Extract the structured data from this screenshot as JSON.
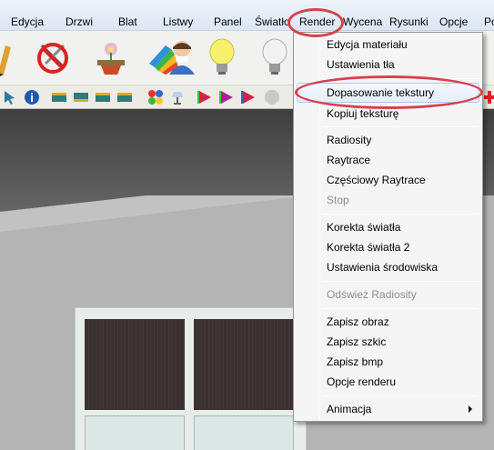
{
  "menubar": {
    "items": [
      "Edycja",
      "Drzwi",
      "Blat",
      "Listwy",
      "Panel",
      "Światło",
      "Render",
      "Wycena",
      "Rysunki",
      "Opcje",
      "Pomoc"
    ]
  },
  "render_menu": {
    "items": [
      {
        "label": "Edycja materiału",
        "enabled": true
      },
      {
        "label": "Ustawienia tła",
        "enabled": true
      },
      {
        "label": "Dopasowanie tekstury",
        "enabled": true,
        "highlighted": true
      },
      {
        "label": "Kopiuj teksturę",
        "enabled": true
      },
      {
        "label": "Radiosity",
        "enabled": true
      },
      {
        "label": "Raytrace",
        "enabled": true
      },
      {
        "label": "Częściowy Raytrace",
        "enabled": true
      },
      {
        "label": "Stop",
        "enabled": false
      },
      {
        "label": "Korekta światła",
        "enabled": true
      },
      {
        "label": "Korekta światła 2",
        "enabled": true
      },
      {
        "label": "Ustawienia środowiska",
        "enabled": true
      },
      {
        "label": "Odśwież Radiosity",
        "enabled": false
      },
      {
        "label": "Zapisz obraz",
        "enabled": true
      },
      {
        "label": "Zapisz szkic",
        "enabled": true
      },
      {
        "label": "Zapisz bmp",
        "enabled": true
      },
      {
        "label": "Opcje renderu",
        "enabled": true
      },
      {
        "label": "Animacja",
        "enabled": true,
        "has_submenu": true
      }
    ]
  },
  "icons": {
    "big": [
      "pencil-icon",
      "no-tools-icon",
      "flower-pot-icon",
      "color-swatches-icon",
      "person-icon",
      "light-bulb-on-icon",
      "light-bulb-off-icon"
    ],
    "small": [
      "cursor-icon",
      "info-icon",
      "cabinet-icon",
      "cabinet-icon",
      "cabinet-icon",
      "cabinet-icon",
      "color-dots-icon",
      "lamp-icon",
      "play-icon",
      "play-icon",
      "play-icon",
      "stop-icon"
    ]
  },
  "colors": {
    "annotation": "#d9404f",
    "menu_hover_border": "#aecbf0"
  }
}
